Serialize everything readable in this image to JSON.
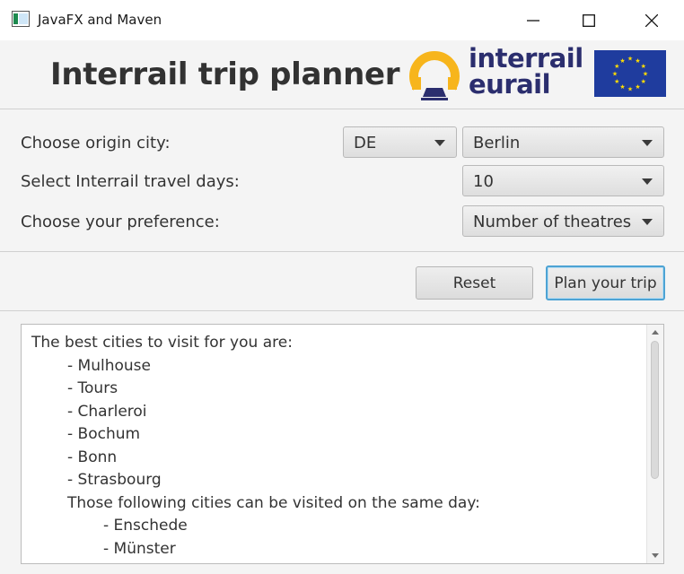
{
  "window": {
    "title": "JavaFX and Maven",
    "minimize_icon": "minimize-icon",
    "maximize_icon": "maximize-icon",
    "close_icon": "close-icon"
  },
  "header": {
    "title": "Interrail trip planner",
    "logo_line1": "interrail",
    "logo_line2": "eurail",
    "colors": {
      "logo_yellow": "#f7b51c",
      "logo_navy": "#2b2e6e",
      "eu_blue": "#1f3c9e",
      "eu_star": "#ffdd00"
    }
  },
  "form": {
    "origin_label": "Choose origin city:",
    "country_value": "DE",
    "city_value": "Berlin",
    "days_label": "Select Interrail travel days:",
    "days_value": "10",
    "preference_label": "Choose your preference:",
    "preference_value": "Number of theatres"
  },
  "actions": {
    "reset_label": "Reset",
    "plan_label": "Plan your trip"
  },
  "result": {
    "intro": "The best cities to visit for you are:",
    "cities": [
      "- Mulhouse",
      "- Tours",
      "- Charleroi",
      "- Bochum",
      "- Bonn",
      "- Strasbourg"
    ],
    "same_day_intro": "Those following cities can be visited on the same day:",
    "same_day_cities": [
      "- Enschede",
      "- Münster"
    ]
  }
}
